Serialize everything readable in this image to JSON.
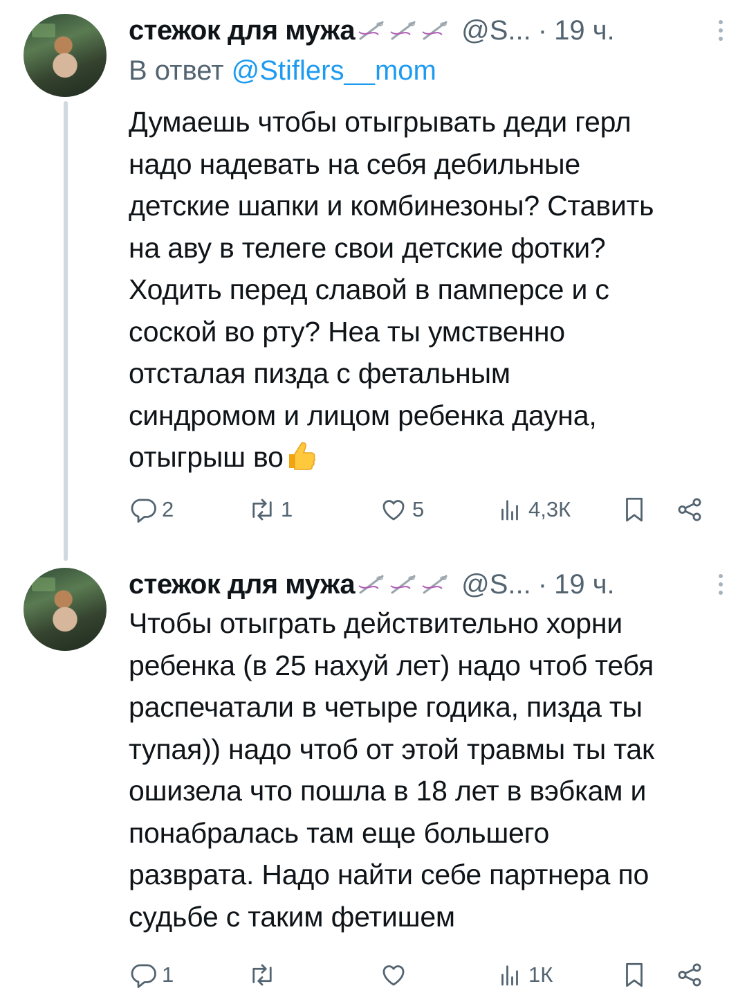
{
  "tweets": [
    {
      "author": "стежок для мужа",
      "handle": "@S...",
      "separator": "·",
      "time": "19 ч.",
      "reply_prefix": "В ответ ",
      "reply_mention": "@Stiflers__mom",
      "lines": [
        "Думаешь чтобы отыгрывать деди герл",
        "надо надевать на себя дебильные",
        "детские шапки и комбинезоны? Ставить",
        "на аву в телеге свои детские фотки?",
        "Ходить перед славой в памперсе и с",
        "соской во рту? Неа ты умственно",
        "отсталая пизда с фетальным",
        "синдромом и лицом ребенка дауна,",
        "отыгрыш во"
      ],
      "emoji": "thumbs-up",
      "stats": {
        "replies": "2",
        "retweets": "1",
        "likes": "5",
        "views": "4,3К"
      }
    },
    {
      "author": "стежок для мужа",
      "handle": "@S...",
      "separator": "·",
      "time": "19 ч.",
      "lines": [
        "Чтобы отыграть действительно хорни",
        "ребенка (в 25 нахуй лет) надо чтоб тебя",
        "распечатали в четыре годика, пизда ты",
        "тупая)) надо чтоб от этой травмы ты так",
        "ошизела что пошла в 18 лет в вэбкам и",
        "понабралась там еще большего",
        "разврата. Надо найти себе партнера по",
        "судьбе с таким фетишем"
      ],
      "stats": {
        "replies": "1",
        "retweets": "",
        "likes": "",
        "views": "1К"
      }
    }
  ],
  "icons": {
    "name_decoration": "needle-and-thread",
    "reply": "reply-icon",
    "retweet": "retweet-icon",
    "like": "heart-icon",
    "views": "views-icon",
    "bookmark": "bookmark-icon",
    "share": "share-icon"
  },
  "colors": {
    "link": "#1d9bf0",
    "secondary": "#536471",
    "thread_line": "#cfd9de"
  }
}
